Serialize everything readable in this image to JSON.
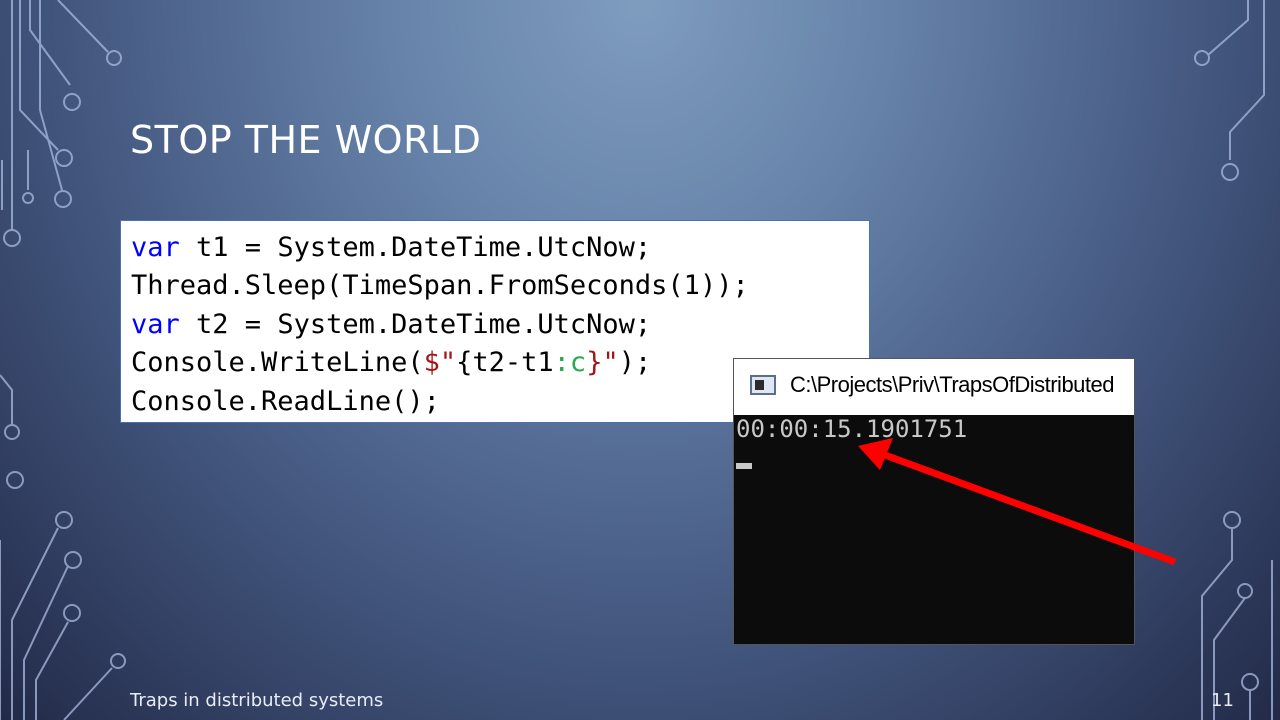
{
  "slide": {
    "title": "STOP THE WORLD",
    "footer": "Traps in distributed systems",
    "page_number": "11"
  },
  "code": {
    "lines": [
      {
        "kw": "var",
        "text": " t1 = System.DateTime.UtcNow;"
      },
      {
        "text": "Thread.Sleep(TimeSpan.FromSeconds(1));"
      },
      {
        "kw": "var",
        "text": " t2 = System.DateTime.UtcNow;"
      },
      {
        "pre": "Console.WriteLine(",
        "dollar": "$\"",
        "interp_open": "{t2-t1",
        "format": ":c",
        "interp_close": "}\"",
        "post": ");"
      },
      {
        "text": "Console.ReadLine();"
      }
    ]
  },
  "console": {
    "title": "C:\\Projects\\Priv\\TrapsOfDistributed",
    "output": "00:00:15.1901751",
    "icon": "console-window-icon"
  },
  "colors": {
    "keyword": "#0000ff",
    "string": "#a31515",
    "format": "#2aa84f",
    "arrow": "#ff0000"
  }
}
